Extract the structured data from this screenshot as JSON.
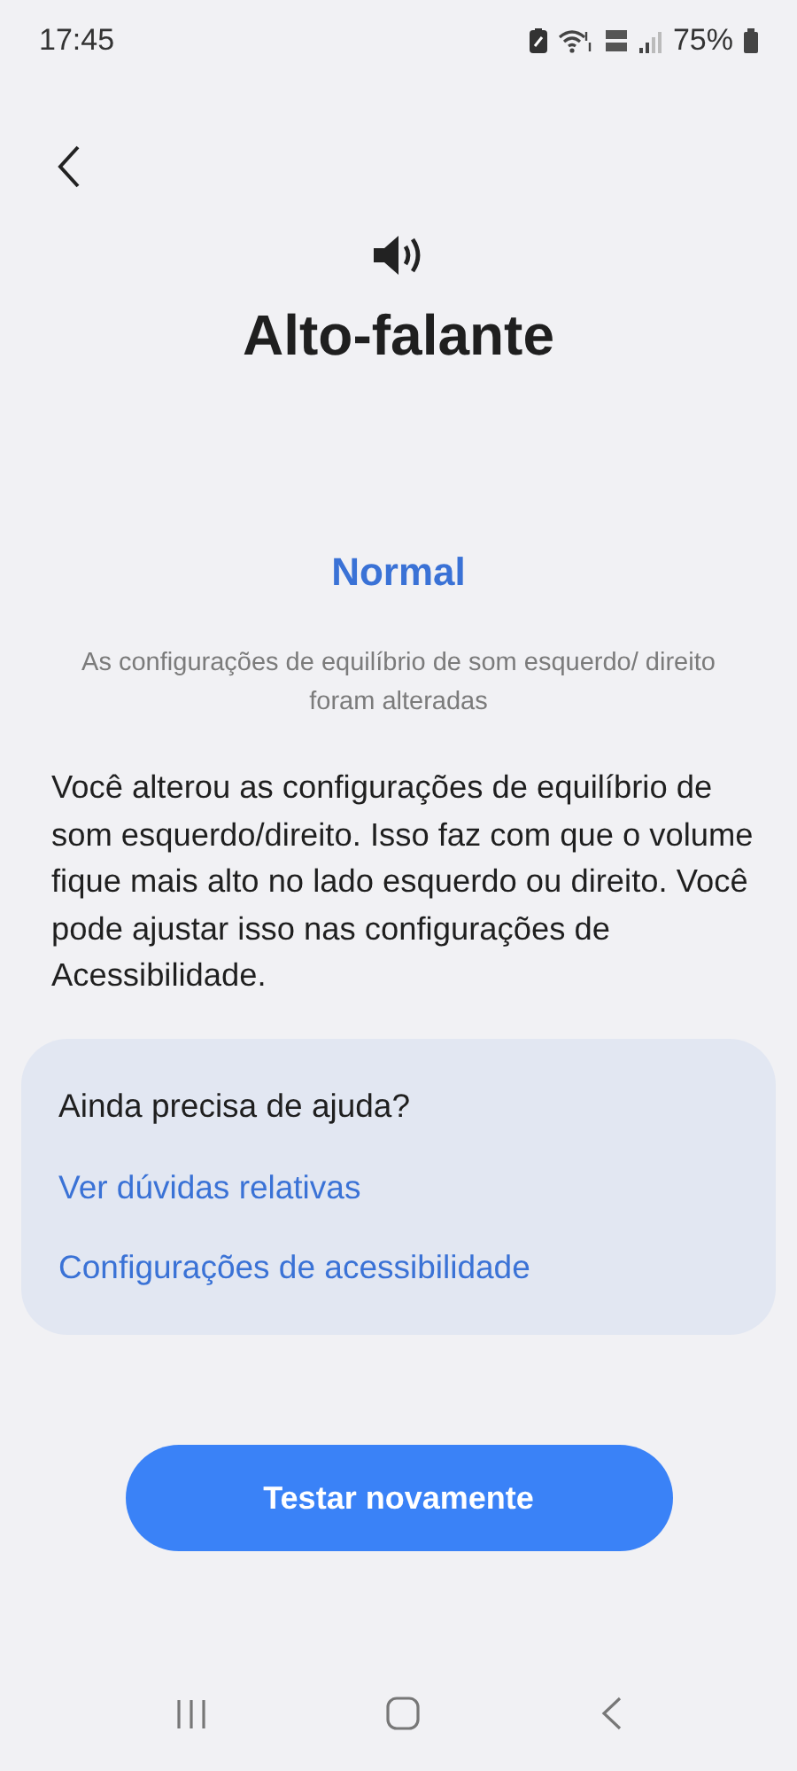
{
  "status_bar": {
    "time": "17:45",
    "battery": "75%"
  },
  "title": "Alto-falante",
  "result": "Normal",
  "note": "As configurações de equilíbrio de som esquerdo/ direito foram alteradas",
  "description": "Você alterou as configurações de equilíbrio de som esquerdo/direito. Isso faz com que o volume fique mais alto no lado esquerdo ou direito. Você pode ajustar isso nas configurações de Acessibilidade.",
  "help_card": {
    "heading": "Ainda precisa de ajuda?",
    "links": [
      "Ver dúvidas relativas",
      "Configurações de acessibilidade"
    ]
  },
  "action_button": "Testar novamente"
}
